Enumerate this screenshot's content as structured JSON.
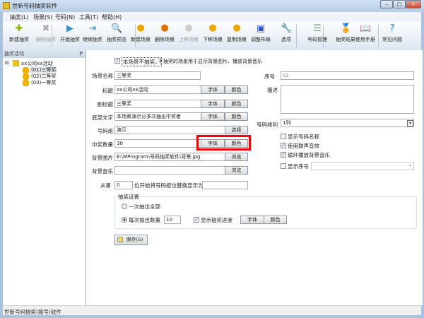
{
  "window": {
    "title": "世新号码抽奖软件",
    "min": "–",
    "max": "□",
    "close": "×"
  },
  "menu": [
    "抽奖(L)",
    "场景(S)",
    "号码(N)",
    "工具(T)",
    "帮助(H)"
  ],
  "toolbar": [
    {
      "label": "新建抽奖",
      "icon": "new-lottery-icon",
      "glyph": "✚",
      "color": "#8bb800"
    },
    {
      "label": "删除抽奖",
      "icon": "delete-icon",
      "glyph": "✖",
      "color": "#aaa",
      "disabled": true
    },
    {
      "label": "开始抽奖",
      "icon": "play-icon",
      "glyph": "▶",
      "color": "#3b8fd6"
    },
    {
      "label": "继续抽奖",
      "icon": "continue-icon",
      "glyph": "⇥",
      "color": "#3b8fd6"
    },
    {
      "label": "抽奖预览",
      "icon": "magnifier-icon",
      "glyph": "🔍",
      "color": "#d89a1a"
    },
    {
      "label": "新建场景",
      "icon": "add-scene-icon",
      "glyph": "⬢",
      "color": "#f0a800"
    },
    {
      "label": "删除场景",
      "icon": "delete-scene-icon",
      "glyph": "⬢",
      "color": "#e07000"
    },
    {
      "label": "上移场景",
      "icon": "move-up-icon",
      "glyph": "⬢",
      "color": "#ccc",
      "disabled": true
    },
    {
      "label": "下移场景",
      "icon": "move-down-icon",
      "glyph": "⬢",
      "color": "#f0a800"
    },
    {
      "label": "复制场景",
      "icon": "copy-scene-icon",
      "glyph": "⬢",
      "color": "#f0a800"
    },
    {
      "label": "调整布局",
      "icon": "layout-icon",
      "glyph": "▣",
      "color": "#3355cc"
    },
    {
      "label": "选项",
      "icon": "wrench-icon",
      "glyph": "🔧",
      "color": "#888"
    },
    {
      "label": "号码管理",
      "icon": "list-icon",
      "glyph": "☰",
      "color": "#6a6"
    },
    {
      "label": "抽奖结果",
      "icon": "medal-icon",
      "glyph": "🏅",
      "color": "#e0b000"
    },
    {
      "label": "使用手册",
      "icon": "book-icon",
      "glyph": "📖",
      "color": "#a66"
    },
    {
      "label": "常见问题",
      "icon": "help-icon",
      "glyph": "?",
      "color": "#1a7fd8"
    }
  ],
  "left_panel": {
    "title": "抽奖活动",
    "pin": "ᵽ",
    "root": "xx公司xx活动",
    "items": [
      "(01)三等奖",
      "(02)二等奖",
      "(03)一等奖"
    ]
  },
  "form": {
    "no_draw_label": "本场景不抽奖。",
    "no_draw_hint": "不抽奖的场景用于显示背景图片、播放背景音乐",
    "scene_name_label": "场景名称",
    "scene_name": "三等奖",
    "title_label": "标题",
    "title": "xx公司xx活动",
    "subtitle_label": "副标题",
    "subtitle": "三等奖",
    "footer_label": "底部文字",
    "footer": "本场景演示分多次抽出中奖者",
    "group_label": "号码组",
    "group": "演示",
    "select": "选择",
    "count_label": "中奖数量",
    "count": "30",
    "bg_image_label": "背景图片",
    "bg_image": "E:\\MProgram\\号码抽奖软件\\背景.jpg",
    "bg_music_label": "背景音乐",
    "bg_music": "",
    "browse": "浏览",
    "font": "字体",
    "color": "颜色",
    "from_label": "从第",
    "from_value": "0",
    "from_hint": "位开始将号码按位替换显示为",
    "replace": "",
    "group_title": "抽奖设置",
    "radio_all": "一次抽出全部",
    "radio_each": "每次抽出数量",
    "each_value": "10",
    "progress_label": "显示抽奖进度",
    "save": "保存(S)",
    "seq_label": "序号",
    "seq": "01",
    "desc_label": "描述",
    "desc": "",
    "arrange_label": "号码排列",
    "arrange": "1列",
    "show_name": "显示号码名称",
    "drum": "使用鼓声音效",
    "loop_music": "循环播放背景音乐",
    "show_seq": "显示序号",
    "seq_combo": ""
  },
  "status": "世新号码抽奖(摇号)软件",
  "highlight_color": "#ff0000"
}
